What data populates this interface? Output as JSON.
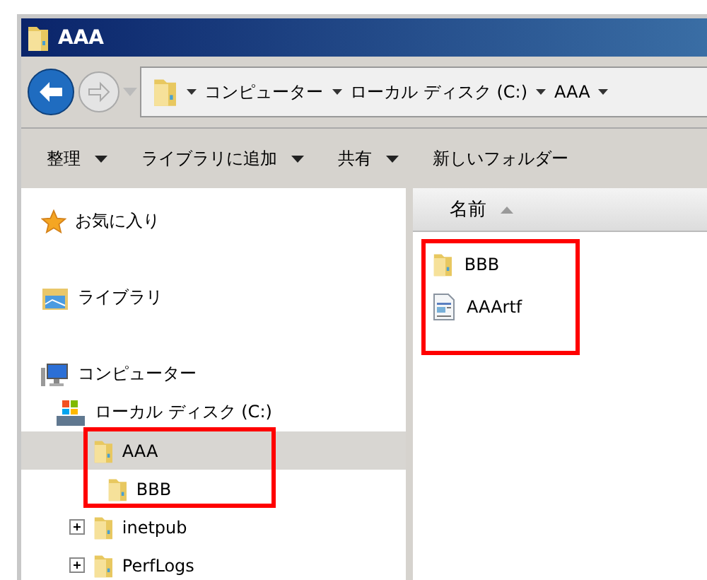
{
  "window": {
    "title": "AAA"
  },
  "address": {
    "segments": [
      "コンピューター",
      "ローカル ディスク (C:)",
      "AAA"
    ],
    "trailing_caret": true
  },
  "toolbar": [
    {
      "label": "整理",
      "dropdown": true
    },
    {
      "label": "ライブラリに追加",
      "dropdown": true
    },
    {
      "label": "共有",
      "dropdown": true
    },
    {
      "label": "新しいフォルダー",
      "dropdown": false
    }
  ],
  "navigation": [
    {
      "kind": "favorites",
      "label": "お気に入り",
      "selected": false,
      "highlighted": false
    },
    {
      "kind": "library",
      "label": "ライブラリ",
      "selected": false,
      "highlighted": false
    },
    {
      "kind": "computer",
      "label": "コンピューター",
      "selected": false,
      "highlighted": false,
      "children": [
        {
          "kind": "drive",
          "label": "ローカル ディスク (C:)",
          "selected": false,
          "highlighted": false,
          "children": [
            {
              "kind": "folder",
              "label": "AAA",
              "selected": true,
              "has_children": false,
              "highlighted": true,
              "children": [
                {
                  "kind": "folder",
                  "label": "BBB",
                  "selected": false,
                  "has_children": false,
                  "highlighted": false
                }
              ]
            },
            {
              "kind": "folder",
              "label": "inetpub",
              "selected": false,
              "has_children": true,
              "highlighted": false
            },
            {
              "kind": "folder",
              "label": "PerfLogs",
              "selected": false,
              "has_children": true,
              "highlighted": false
            }
          ]
        }
      ]
    }
  ],
  "file_list": {
    "columns": [
      {
        "label": "名前",
        "sorted": true
      }
    ],
    "highlighted": true,
    "items": [
      {
        "kind": "folder",
        "name": "BBB"
      },
      {
        "kind": "document",
        "name": "AAArtf"
      }
    ]
  }
}
